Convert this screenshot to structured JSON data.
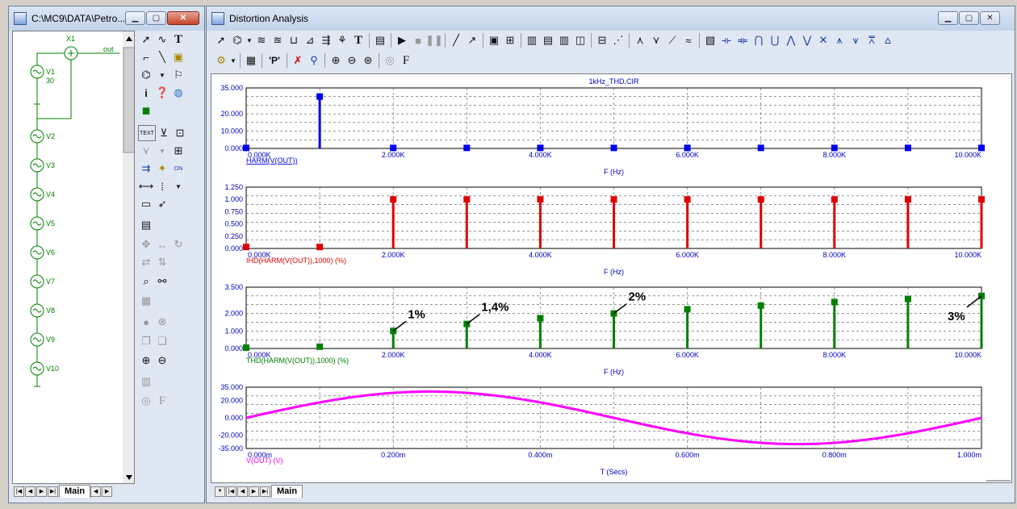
{
  "left_window": {
    "title": "C:\\MC9\\DATA\\Petro...",
    "tab": "Main",
    "components": [
      {
        "name": "X1"
      },
      {
        "name": "out"
      },
      {
        "name": "V1",
        "value": "30"
      },
      {
        "name": "V2"
      },
      {
        "name": "V3"
      },
      {
        "name": "V4"
      },
      {
        "name": "V5"
      },
      {
        "name": "V6"
      },
      {
        "name": "V7"
      },
      {
        "name": "V8"
      },
      {
        "name": "V9"
      },
      {
        "name": "V10"
      }
    ],
    "palette_text_tool": "TEXT",
    "palette_on_label": "ON",
    "palette_font_label": "F"
  },
  "right_window": {
    "title": "Distortion Analysis",
    "tab": "Main",
    "toolbar_p_label": "'P'",
    "toolbar_f_label": "F"
  },
  "chart_data": [
    {
      "type": "bar",
      "title": "1kHz_THD.CIR",
      "series_label": "HARM(V(OUT))",
      "xlabel": "F (Hz)",
      "x_ticks": [
        "0.000K",
        "2.000K",
        "4.000K",
        "6.000K",
        "8.000K",
        "10.000K"
      ],
      "y_ticks": [
        "0.000",
        "10.000",
        "20.000",
        "35.000"
      ],
      "ylim": [
        0,
        35
      ],
      "xlim": [
        0,
        10000
      ],
      "x": [
        0,
        1000,
        2000,
        3000,
        4000,
        5000,
        6000,
        7000,
        8000,
        9000,
        10000
      ],
      "values": [
        0.3,
        30,
        0.3,
        0.3,
        0.3,
        0.3,
        0.3,
        0.3,
        0.3,
        0.3,
        0.3
      ],
      "color": "#0000ee"
    },
    {
      "type": "bar",
      "series_label": "IHD(HARM(V(OUT)),1000) (%)",
      "xlabel": "F (Hz)",
      "x_ticks": [
        "0.000K",
        "2.000K",
        "4.000K",
        "6.000K",
        "8.000K",
        "10.000K"
      ],
      "y_ticks": [
        "0.000",
        "0.250",
        "0.500",
        "0.750",
        "1.000",
        "1.250"
      ],
      "ylim": [
        0,
        1.25
      ],
      "xlim": [
        0,
        10000
      ],
      "x": [
        0,
        1000,
        2000,
        3000,
        4000,
        5000,
        6000,
        7000,
        8000,
        9000,
        10000
      ],
      "values": [
        0.03,
        0.03,
        1,
        1,
        1,
        1,
        1,
        1,
        1,
        1,
        1
      ],
      "color": "#e00000"
    },
    {
      "type": "bar",
      "series_label": "THD(HARM(V(OUT)),1000) (%)",
      "xlabel": "F (Hz)",
      "x_ticks": [
        "0.000K",
        "2.000K",
        "4.000K",
        "6.000K",
        "8.000K",
        "10.000K"
      ],
      "y_ticks": [
        "0.000",
        "1.000",
        "2.000",
        "3.500"
      ],
      "ylim": [
        0,
        3.5
      ],
      "xlim": [
        0,
        10000
      ],
      "x": [
        0,
        1000,
        2000,
        3000,
        4000,
        5000,
        6000,
        7000,
        8000,
        9000,
        10000
      ],
      "values": [
        0.05,
        0.1,
        1.0,
        1.4,
        1.73,
        2.0,
        2.24,
        2.45,
        2.65,
        2.83,
        3.0
      ],
      "color": "#008000",
      "annotations": [
        {
          "text": "1%",
          "x": 2000,
          "y": 1.0
        },
        {
          "text": "1,4%",
          "x": 3000,
          "y": 1.4
        },
        {
          "text": "2%",
          "x": 5000,
          "y": 2.0
        },
        {
          "text": "3%",
          "x": 10000,
          "y": 3.0
        }
      ]
    },
    {
      "type": "line",
      "series_label": "V(OUT) (V)",
      "xlabel": "T (Secs)",
      "x_ticks": [
        "0.000m",
        "0.200m",
        "0.400m",
        "0.600m",
        "0.800m",
        "1.000m"
      ],
      "y_ticks": [
        "-35.000",
        "-20.000",
        "0.000",
        "20.000",
        "35.000"
      ],
      "ylim": [
        -35,
        35
      ],
      "xlim": [
        0,
        0.001
      ],
      "amplitude": 30,
      "frequency_hz": 1000,
      "color": "#ff00ff"
    }
  ]
}
